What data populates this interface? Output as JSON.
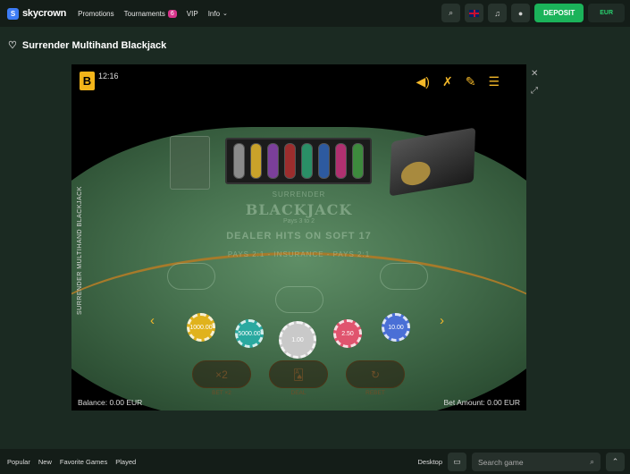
{
  "header": {
    "brand": "skycrown",
    "brand_mark": "S",
    "nav": [
      {
        "label": "Promotions"
      },
      {
        "label": "Tournaments",
        "badge": "6"
      },
      {
        "label": "VIP"
      },
      {
        "label": "Info"
      }
    ],
    "deposit_label": "DEPOSIT",
    "currency": "EUR",
    "icons": [
      "search-icon",
      "flag-icon",
      "bell-icon",
      "user-icon"
    ]
  },
  "game_title": "Surrender Multihand Blackjack",
  "game": {
    "provider_mark": "B",
    "clock": "12:16",
    "vertical_label": "SURRENDER MULTIHAND BLACKJACK",
    "table_text": {
      "line1": "SURRENDER",
      "line2": "BLACKJACK",
      "line3": "Pays 3 to 2",
      "line4": "DEALER HITS ON SOFT 17",
      "line5": "PAYS 2:1 - INSURANCE - PAYS 2:1"
    },
    "chips": [
      {
        "label": "1000.00",
        "color": "#e0b21c"
      },
      {
        "label": "5000.00",
        "color": "#2aa9a0"
      },
      {
        "label": "1.00",
        "color": "#c9c9c9"
      },
      {
        "label": "2.50",
        "color": "#e0546e"
      },
      {
        "label": "10.00",
        "color": "#4a6fd6"
      }
    ],
    "actions": [
      {
        "label": "BET ×2",
        "icon": "×2"
      },
      {
        "label": "DEAL",
        "icon": "cards-icon"
      },
      {
        "label": "REBET",
        "icon": "rebet-icon"
      }
    ],
    "balance_label": "Balance: 0.00 EUR",
    "bet_label": "Bet Amount: 0.00 EUR"
  },
  "footer": {
    "tabs": [
      "Popular",
      "New",
      "Favorite Games",
      "Played"
    ],
    "desktop_label": "Desktop",
    "search_placeholder": "Search game"
  }
}
